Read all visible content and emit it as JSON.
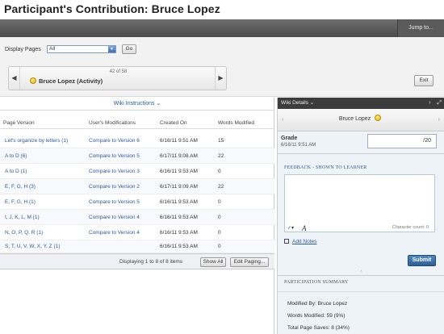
{
  "header": {
    "title": "Participant's Contribution: Bruce Lopez",
    "jump_to": "Jump to..."
  },
  "controls": {
    "display_pages_label": "Display Pages",
    "display_pages_value": "All",
    "go_label": "Go",
    "nav_count": "42 of 58",
    "nav_user": "Bruce Lopez (Activity)",
    "exit_label": "Exit"
  },
  "table": {
    "instructions_label": "Wiki Instructions",
    "columns": [
      "Page Version",
      "User's Modifications",
      "Created On",
      "Words Modified"
    ],
    "rows": [
      {
        "page": "Let's organize by letters (1)",
        "mod": "Compare to Version 6",
        "created": "6/16/11 9:51 AM",
        "words": "15"
      },
      {
        "page": "A to D (6)",
        "mod": "Compare to Version 5",
        "created": "6/17/11 9:08 AM",
        "words": "22"
      },
      {
        "page": "A to D (1)",
        "mod": "Compare to Version 3",
        "created": "6/16/11 9:53 AM",
        "words": "0"
      },
      {
        "page": "E, F, G, H (3)",
        "mod": "Compare to Version 2",
        "created": "6/17/11 9:09 AM",
        "words": "22"
      },
      {
        "page": "E, F, G, H (1)",
        "mod": "Compare to Version 5",
        "created": "6/16/11 9:53 AM",
        "words": "0"
      },
      {
        "page": "I, J, K, L, M (1)",
        "mod": "Compare to Version 4",
        "created": "6/16/11 9:53 AM",
        "words": "0"
      },
      {
        "page": "N, O, P, Q, R (1)",
        "mod": "Compare to Version 4",
        "created": "6/16/11 9:53 AM",
        "words": "0"
      },
      {
        "page": "S, T, U, V, W, X, Y, Z (1)",
        "mod": "",
        "created": "6/16/11 9:53 AM",
        "words": "0"
      }
    ],
    "footer_text": "Displaying 1 to 8 of 8 items",
    "show_all": "Show All",
    "edit_paging": "Edit Paging..."
  },
  "details": {
    "header": "Wiki Details",
    "user": "Bruce Lopez",
    "grade_label": "Grade",
    "grade_date": "6/16/11 9:51 AM",
    "grade_out_of": "/20",
    "feedback_title": "FEEDBACK - SHOWN TO LEARNER",
    "character_count": "Character count: 0",
    "add_notes": "Add Notes",
    "submit": "Submit",
    "participation_title": "PARTICIPATION SUMMARY",
    "modified_by": "Modified By: Bruce Lopez",
    "words_modified": "Words Modified: 59 (9%)",
    "total_page_saves": "Total Page Saves: 8 (34%)"
  }
}
